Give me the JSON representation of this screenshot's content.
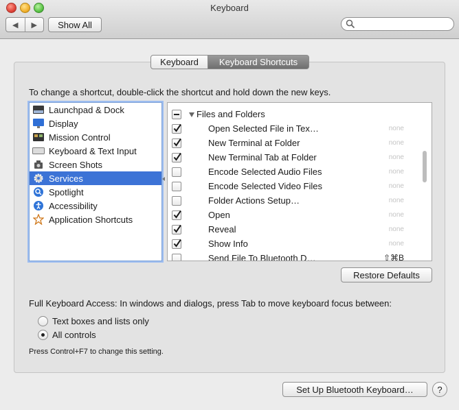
{
  "window": {
    "title": "Keyboard"
  },
  "toolbar": {
    "back_label": "◀",
    "forward_label": "▶",
    "show_all_label": "Show All",
    "search_value": "",
    "search_placeholder": ""
  },
  "tabs": [
    {
      "label": "Keyboard",
      "selected": false
    },
    {
      "label": "Keyboard Shortcuts",
      "selected": true
    }
  ],
  "instruction": "To change a shortcut, double-click the shortcut and hold down the new keys.",
  "categories": [
    {
      "label": "Launchpad & Dock",
      "icon": "launchpad-icon"
    },
    {
      "label": "Display",
      "icon": "display-icon"
    },
    {
      "label": "Mission Control",
      "icon": "mission-control-icon"
    },
    {
      "label": "Keyboard & Text Input",
      "icon": "keyboard-icon"
    },
    {
      "label": "Screen Shots",
      "icon": "screenshot-icon"
    },
    {
      "label": "Services",
      "icon": "services-gear-icon",
      "selected": true
    },
    {
      "label": "Spotlight",
      "icon": "spotlight-icon"
    },
    {
      "label": "Accessibility",
      "icon": "accessibility-icon"
    },
    {
      "label": "Application Shortcuts",
      "icon": "app-shortcuts-icon"
    }
  ],
  "shortcuts": {
    "group_label": "Files and Folders",
    "items": [
      {
        "label": "Open Selected File in Tex…",
        "checked": true,
        "key": "none"
      },
      {
        "label": "New Terminal at Folder",
        "checked": true,
        "key": "none"
      },
      {
        "label": "New Terminal Tab at Folder",
        "checked": true,
        "key": "none"
      },
      {
        "label": "Encode Selected Audio Files",
        "checked": false,
        "key": "none"
      },
      {
        "label": "Encode Selected Video Files",
        "checked": false,
        "key": "none"
      },
      {
        "label": "Folder Actions Setup…",
        "checked": false,
        "key": "none"
      },
      {
        "label": "Open",
        "checked": true,
        "key": "none"
      },
      {
        "label": "Reveal",
        "checked": true,
        "key": "none"
      },
      {
        "label": "Show Info",
        "checked": true,
        "key": "none"
      },
      {
        "label": "Send File To Bluetooth D…",
        "checked": false,
        "key": "⇧⌘B"
      }
    ]
  },
  "restore_defaults_label": "Restore Defaults",
  "full_keyboard_access": {
    "label": "Full Keyboard Access: In windows and dialogs, press Tab to move keyboard focus between:",
    "options": [
      {
        "label": "Text boxes and lists only",
        "selected": false
      },
      {
        "label": "All controls",
        "selected": true
      }
    ],
    "hint": "Press Control+F7 to change this setting."
  },
  "bluetooth_button_label": "Set Up Bluetooth Keyboard…",
  "help_label": "?",
  "colors": {
    "selection": "#3c73d6",
    "focus_ring": "#9dbdf0"
  }
}
